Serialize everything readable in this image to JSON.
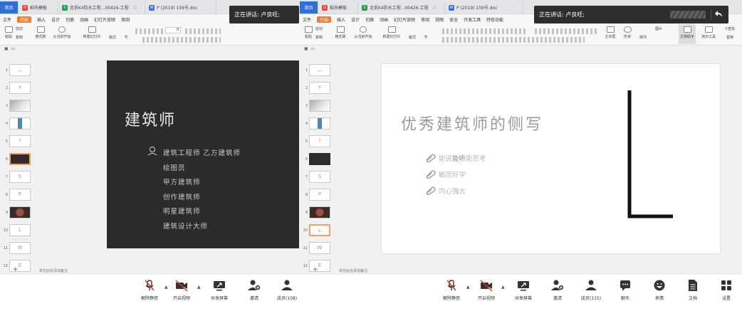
{
  "left": {
    "tabs": [
      {
        "label": "首页",
        "kind": "home"
      },
      {
        "label": "稻壳模板",
        "kind": "docer"
      },
      {
        "label": "北侣K4防水工程...00426-工程",
        "kind": "xls"
      },
      {
        "label": "P (2019) 159号.doc",
        "kind": "doc"
      }
    ],
    "menu": [
      "文件",
      "开始",
      "插入",
      "设计",
      "切换",
      "动画",
      "幻灯片放映",
      "审阅"
    ],
    "menu_active": "开始",
    "ribbon_labels": [
      "粘贴",
      "剪切",
      "复制",
      "格式刷",
      "从当前开始",
      "新建幻灯片",
      "版式",
      "节"
    ],
    "font_size_value": "0",
    "notes_placeholder": "单击此处添加备注",
    "thumbnail_numbers": [
      "1",
      "2",
      "3",
      "4",
      "5",
      "6",
      "7",
      "8",
      "9",
      "10",
      "11",
      "12"
    ],
    "thumbnail_glyphs": [
      "",
      "Y",
      "",
      "",
      "?",
      "",
      "S",
      "P",
      "",
      "L",
      "W",
      "E"
    ],
    "slide": {
      "title": "建筑师",
      "items": [
        "建筑工程师  乙方建筑师",
        "绘图员",
        "甲方建筑师",
        "创作建筑师",
        "明星建筑师",
        "建筑设计大师"
      ]
    },
    "speaking": "正在讲话: 卢良旺;"
  },
  "right": {
    "tabs": [
      {
        "label": "首页",
        "kind": "home"
      },
      {
        "label": "稻壳模板",
        "kind": "docer"
      },
      {
        "label": "北侣K4防水工程...00426-工程",
        "kind": "xls"
      },
      {
        "label": "P (2019) 159号.doc",
        "kind": "doc"
      }
    ],
    "menu": [
      "文件",
      "开始",
      "插入",
      "设计",
      "切换",
      "动画",
      "幻灯片放映",
      "审阅",
      "视图",
      "安全",
      "开发工具",
      "特色功能"
    ],
    "menu_active": "开始",
    "ribbon_labels": [
      "粘贴",
      "剪切",
      "复制",
      "格式刷",
      "从当前开始",
      "新建幻灯片",
      "版式",
      "节",
      "文本框",
      "形状",
      "排列",
      "图片",
      "文档助手",
      "演示工具",
      "查找",
      "替换"
    ],
    "notes_placeholder": "单击此处添加备注",
    "thumbnail_numbers": [
      "1",
      "2",
      "3",
      "4",
      "5",
      "6",
      "7",
      "8",
      "9",
      "10",
      "11",
      "12"
    ],
    "thumbnail_glyphs": [
      "",
      "Y",
      "",
      "",
      "?",
      "",
      "S",
      "P",
      "",
      "L",
      "W",
      "E"
    ],
    "slide": {
      "title": "优秀建筑师的侧写",
      "bullets": [
        {
          "pre": "能说",
          "em": "能听",
          "post": "能思考"
        },
        {
          "pre": "敏而好学",
          "em": "",
          "post": ""
        },
        {
          "pre": "内心强大",
          "em": "",
          "post": ""
        }
      ],
      "big_letter": "L"
    },
    "speaking": "正在讲话: 卢良旺;"
  },
  "bottom_left": {
    "controls": [
      {
        "label": "解除静音",
        "icon": "mic-muted-icon"
      },
      {
        "label": "开启视频",
        "icon": "camera-off-icon"
      },
      {
        "label": "共享屏幕",
        "icon": "share-screen-icon"
      },
      {
        "label": "邀请",
        "icon": "invite-icon"
      },
      {
        "label": "成员(108)",
        "icon": "members-icon"
      }
    ]
  },
  "bottom_right": {
    "controls": [
      {
        "label": "解除静音",
        "icon": "mic-muted-icon"
      },
      {
        "label": "开启视频",
        "icon": "camera-off-icon"
      },
      {
        "label": "共享屏幕",
        "icon": "share-screen-icon"
      },
      {
        "label": "邀请",
        "icon": "invite-icon"
      },
      {
        "label": "成员(115)",
        "icon": "members-icon"
      },
      {
        "label": "聊天",
        "icon": "chat-icon"
      },
      {
        "label": "表情",
        "icon": "emoji-icon"
      },
      {
        "label": "文档",
        "icon": "document-icon"
      },
      {
        "label": "设置",
        "icon": "settings-icon"
      }
    ]
  },
  "colors": {
    "home_tab": "#2f6fd6",
    "menu_active": "#f17b2e",
    "dark_slide": "#2b2b2b",
    "selected_thumb": "#f5a156"
  }
}
